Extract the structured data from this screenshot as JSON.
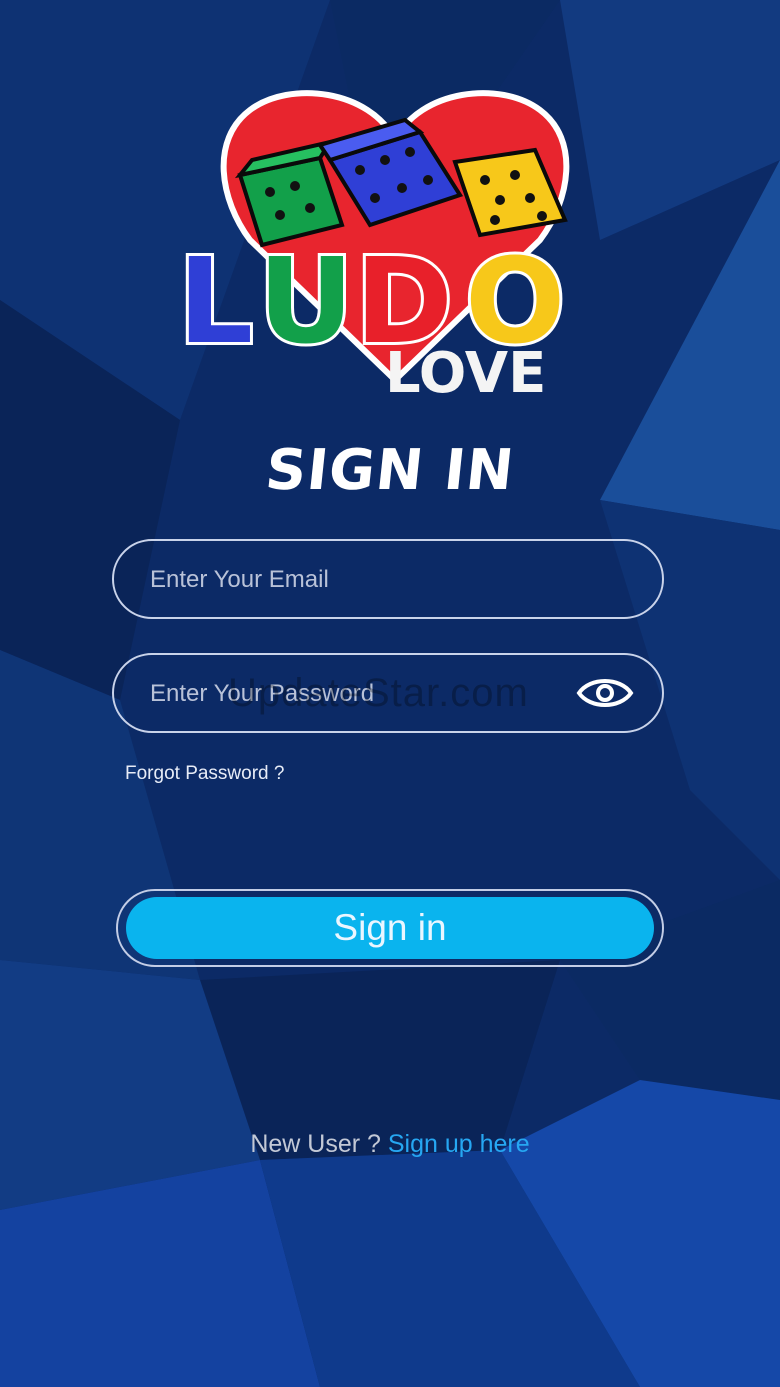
{
  "app": {
    "name": "LUDO LOVE"
  },
  "logo": {
    "word1": "LUDO",
    "word2": "LOVE"
  },
  "title": "SIGN IN",
  "form": {
    "email_placeholder": "Enter Your Email",
    "email_value": "",
    "password_placeholder": "Enter Your Password",
    "password_value": "",
    "password_toggle_icon": "eye-icon",
    "forgot_label": "Forgot Password ?",
    "submit_label": "Sign in"
  },
  "footer": {
    "prompt": "New User ?",
    "signup_label": "Sign up here"
  },
  "watermark": "UpdateStar.com",
  "colors": {
    "background": "#0c2a66",
    "accent": "#0ab4ee",
    "link": "#26a7f2",
    "logo_blue": "#2f3fd6",
    "logo_green": "#12a04a",
    "logo_red": "#e8202a",
    "logo_yellow": "#f7c81a"
  }
}
